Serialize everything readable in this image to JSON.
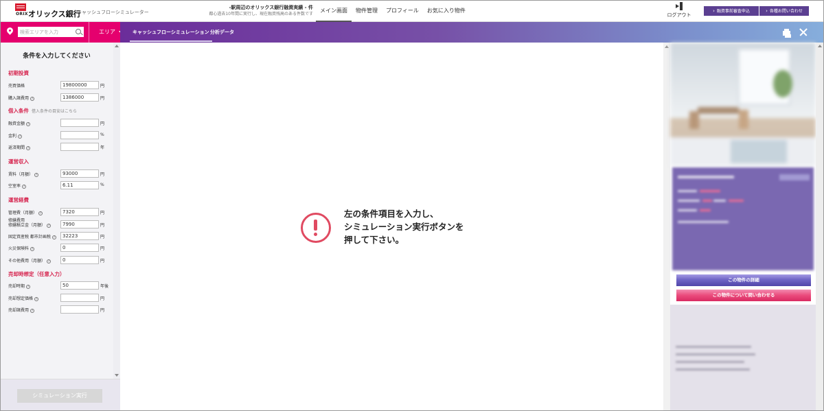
{
  "header": {
    "logo_text": "オリックス銀行",
    "logo_sub": "ORIX",
    "app_title": "キャッシュフローシミュレーター",
    "notice_line1": "-駅周辺のオリックス銀行融資実績 - 件",
    "notice_line2": "都心過去10年間に実行し、現在融資残高のある件数です",
    "nav": [
      {
        "label": "メイン画面",
        "active": true
      },
      {
        "label": "物件管理",
        "active": false
      },
      {
        "label": "プロフィール",
        "active": false
      },
      {
        "label": "お気に入り物件",
        "active": false
      }
    ],
    "logout_label": "ログアウト",
    "btn_precheck": "融資事前審査申込",
    "btn_inquiry": "各種お問い合わせ"
  },
  "searchbar": {
    "placeholder": "検索エリアを入力",
    "area_label": "エリア"
  },
  "tabs": [
    {
      "label": "キャッシュフローシミュレーション",
      "active": true
    },
    {
      "label": "分析データ",
      "active": false
    }
  ],
  "sidebar": {
    "title": "条件を入力してください",
    "sections": {
      "initial": "初期投資",
      "loan": "借入条件",
      "loan_note": "借入条件の目安はこちら",
      "income": "運営収入",
      "expense": "運営経費",
      "sale": "売却時想定（任意入力）"
    },
    "fields": {
      "price": {
        "label": "売買価格",
        "value": "19800000",
        "unit": "円"
      },
      "purchase_cost": {
        "label": "購入諸費用",
        "value": "1386000",
        "unit": "円"
      },
      "loan_amount": {
        "label": "融資金額",
        "value": "",
        "unit": "円"
      },
      "interest": {
        "label": "金利",
        "value": "",
        "unit": "%"
      },
      "term": {
        "label": "返済期間",
        "value": "",
        "unit": "年"
      },
      "rent": {
        "label": "賃料（月額）",
        "value": "93000",
        "unit": "円"
      },
      "vacancy": {
        "label": "空室率",
        "value": "6.11",
        "unit": "%"
      },
      "mgmt_fee": {
        "label": "管理費（月額）",
        "value": "7320",
        "unit": "円"
      },
      "repair_label1": "修繕費用",
      "repair": {
        "label": "修繕積立金（月額）",
        "value": "7990",
        "unit": "円"
      },
      "tax": {
        "label": "固定資産税 都市計画税",
        "value": "32223",
        "unit": "円"
      },
      "insurance": {
        "label": "火災保険料",
        "value": "0",
        "unit": "円"
      },
      "other": {
        "label": "その他費用（月額）",
        "value": "0",
        "unit": "円"
      },
      "sale_time": {
        "label": "売却時期",
        "value": "50",
        "unit": "年後"
      },
      "sale_price": {
        "label": "売却想定価格",
        "value": "",
        "unit": "円"
      },
      "sale_cost": {
        "label": "売却諸費用",
        "value": "",
        "unit": "円"
      }
    },
    "sim_button": "シミュレーション実行"
  },
  "main": {
    "message_line1": "左の条件項目を入力し、",
    "message_line2": "シミュレーション実行ボタンを",
    "message_line3": "押して下さい。"
  },
  "right_panel": {
    "btn_detail": "この物件の詳細",
    "btn_contact": "この物件について問い合わせる"
  },
  "colors": {
    "accent_pink": "#e5006e",
    "alert_red": "#e04a61",
    "section_red": "#d6244e",
    "purple": "#6b2d9a"
  }
}
